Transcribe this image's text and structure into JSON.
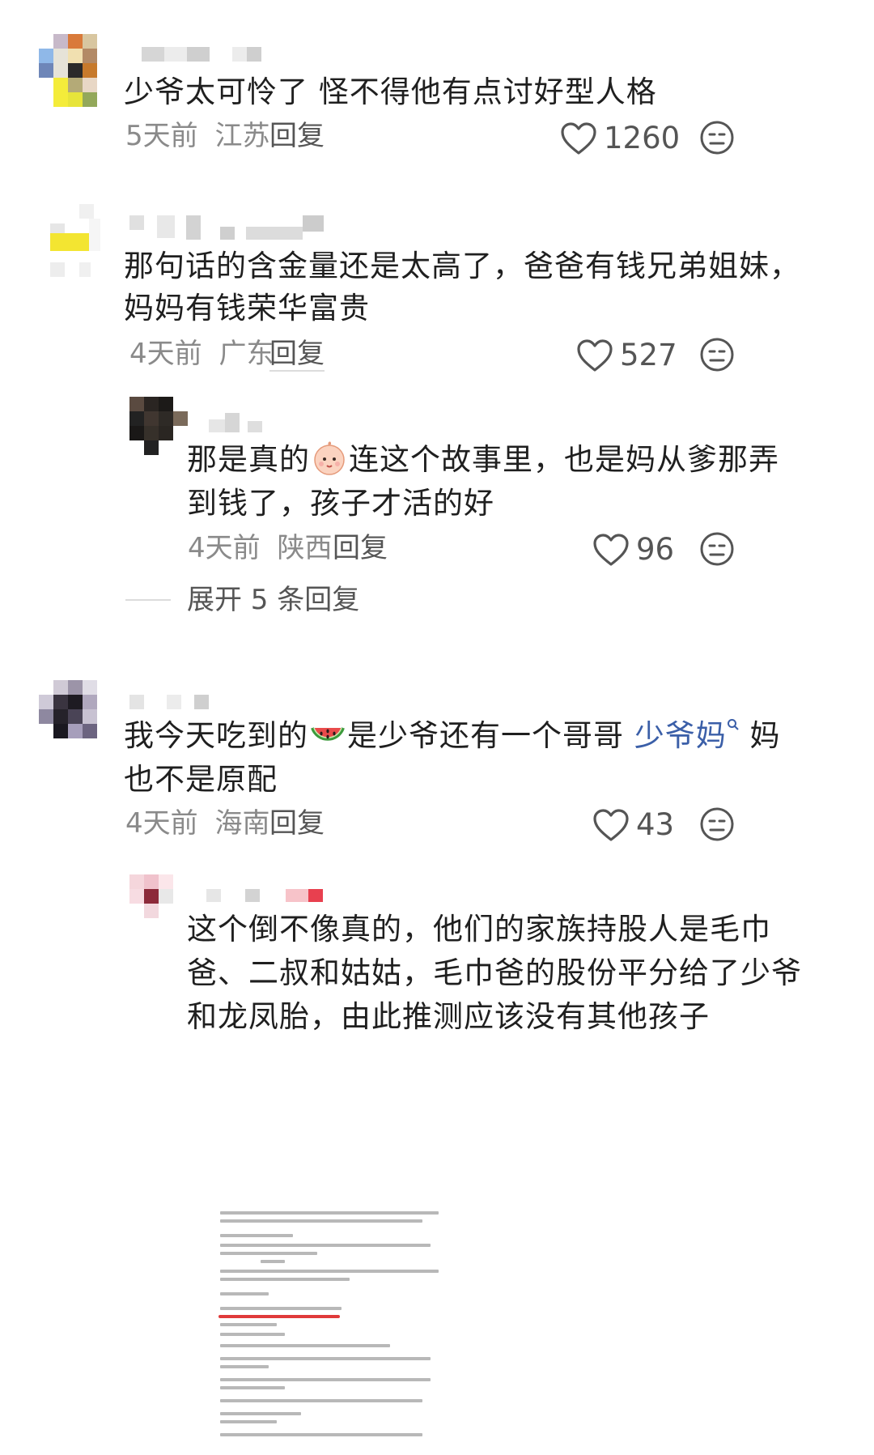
{
  "comments": [
    {
      "text": "少爷太可怜了 怪不得他有点讨好型人格",
      "time": "5天前",
      "location": "江苏",
      "reply_label": "回复",
      "likes": "1260"
    },
    {
      "text_line1": "那句话的含金量还是太高了，爸爸有钱兄弟姐妹，",
      "text_line2": "妈妈有钱荣华富贵",
      "time": "4天前",
      "location": "广东",
      "reply_label": "回复",
      "likes": "527"
    },
    {
      "text_line1_a": "那是真的",
      "text_line1_b": "连这个故事里，也是妈从爹那弄",
      "text_line2": "到钱了，孩子才活的好",
      "time": "4天前",
      "location": "陕西",
      "reply_label": "回复",
      "likes": "96",
      "expand_label": "展开 5 条回复"
    },
    {
      "text_line1_a": "我今天吃到的",
      "text_line1_b": "是少爷还有一个哥哥 ",
      "text_link": "少爷妈",
      "text_line1_c": " 妈",
      "text_line2": "也不是原配",
      "time": "4天前",
      "location": "海南",
      "reply_label": "回复",
      "likes": "43"
    },
    {
      "text_line1": "这个倒不像真的，他们的家族持股人是毛巾",
      "text_line2": "爸、二叔和姑姑，毛巾爸的股份平分给了少爷",
      "text_line3": "和龙凤胎，由此推测应该没有其他孩子"
    }
  ],
  "icons": {
    "like": "heart-outline-icon",
    "emoji": "neutral-face-icon",
    "search": "search-icon"
  },
  "colors": {
    "text": "#1f1f1f",
    "meta": "#8a8a8a",
    "link": "#3b5fa8",
    "underline": "#e03a3a"
  }
}
